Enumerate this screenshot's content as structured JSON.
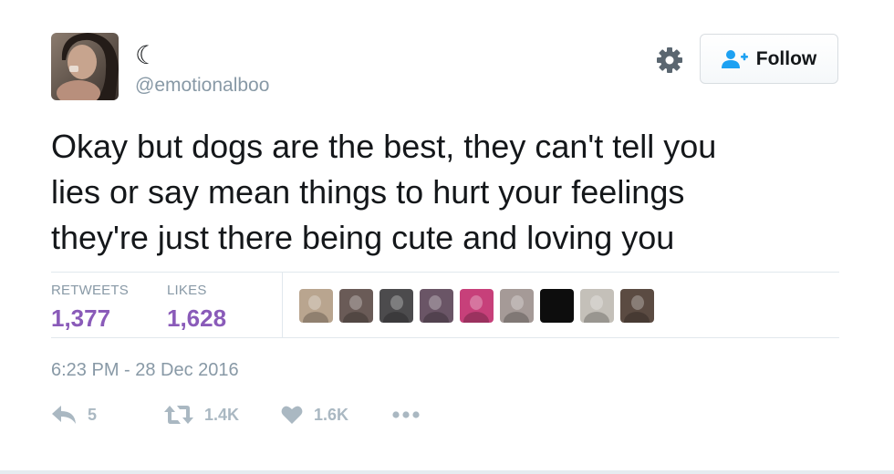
{
  "author": {
    "display_name": "☾",
    "handle": "@emotionalboo"
  },
  "follow_button": {
    "label": "Follow",
    "icon": "add-user-icon"
  },
  "settings_icon": "gear-icon",
  "tweet": {
    "text": "Okay but dogs are the best, they can't tell you\nlies or say mean things to hurt your feelings\nthey're just there being cute and loving you",
    "timestamp": "6:23 PM - 28 Dec 2016"
  },
  "stats": {
    "retweets_label": "RETWEETS",
    "retweets_value": "1,377",
    "likes_label": "LIKES",
    "likes_value": "1,628"
  },
  "likers": [
    {
      "name": "liker-avatar-1",
      "color": "#b9a58f"
    },
    {
      "name": "liker-avatar-2",
      "color": "#6a5b57"
    },
    {
      "name": "liker-avatar-3",
      "color": "#4c4b4d"
    },
    {
      "name": "liker-avatar-4",
      "color": "#6a5566"
    },
    {
      "name": "liker-avatar-5",
      "color": "#c7407a"
    },
    {
      "name": "liker-avatar-6",
      "color": "#a59a97"
    },
    {
      "name": "liker-avatar-7",
      "color": "#0d0d0d"
    },
    {
      "name": "liker-avatar-8",
      "color": "#c4c0b9"
    },
    {
      "name": "liker-avatar-9",
      "color": "#5b4b42"
    }
  ],
  "actions": {
    "reply_count": "5",
    "retweet_count": "1.4K",
    "like_count": "1.6K"
  },
  "colors": {
    "accent_purple": "#8a5bb9",
    "muted_gray": "#8899a6",
    "action_gray": "#aab8c2",
    "follow_blue": "#1da1f2"
  }
}
